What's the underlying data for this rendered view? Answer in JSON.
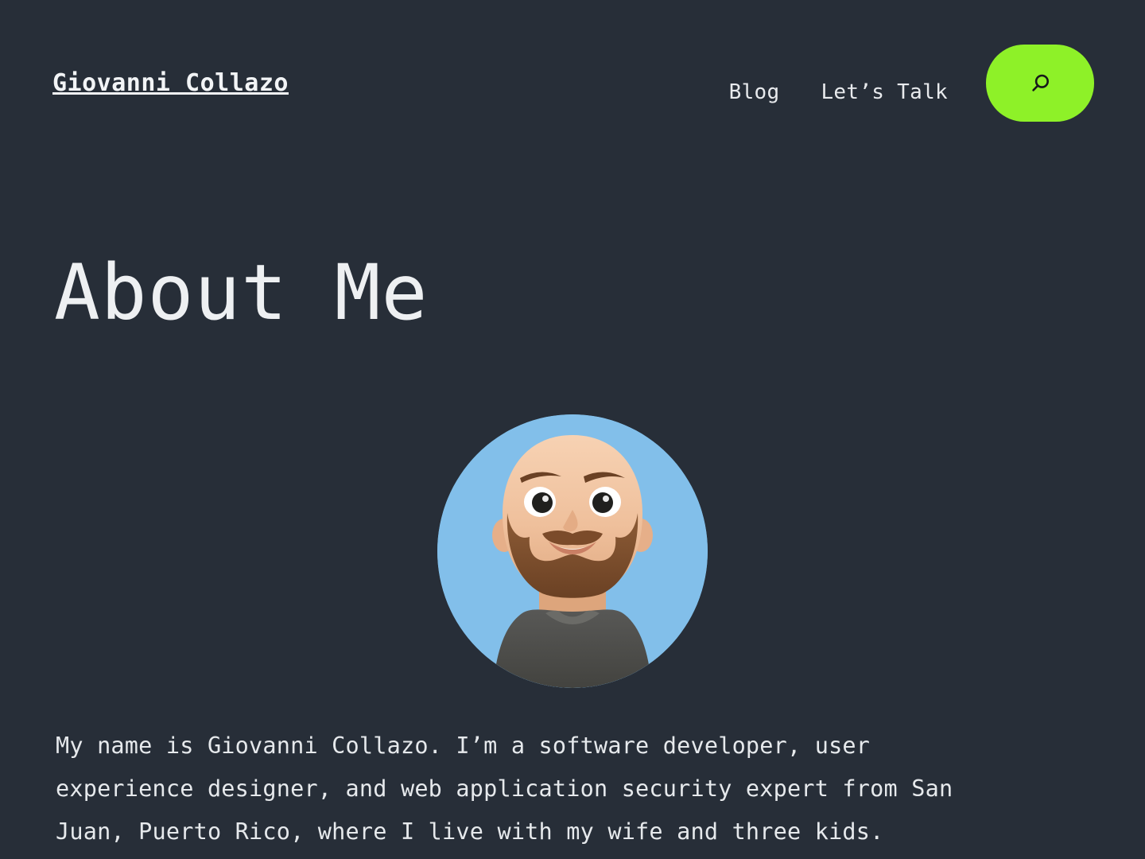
{
  "theme": {
    "background": "#272e38",
    "text": "#e6e9ec",
    "accent": "#8ef128",
    "avatar_background": "#82bfea"
  },
  "header": {
    "site_title": "Giovanni Collazo",
    "nav": [
      {
        "label": "Blog",
        "name": "nav-link-blog"
      },
      {
        "label": "Let’s Talk",
        "name": "nav-link-lets-talk"
      }
    ],
    "search": {
      "icon": "search-icon",
      "aria_label": "Search"
    }
  },
  "main": {
    "page_title": "About Me",
    "avatar": {
      "icon": "memoji-avatar",
      "alt": "Memoji avatar of Giovanni Collazo",
      "background_color": "#82bfea",
      "skin_color": "#f0c3a0",
      "beard_color": "#7d4e2d",
      "shirt_color": "#4c4c4c"
    },
    "about_paragraph": "My name is Giovanni Collazo. I’m a software developer, user experience designer, and web application security expert from San Juan, Puerto Rico, where I live with my wife and three kids."
  }
}
